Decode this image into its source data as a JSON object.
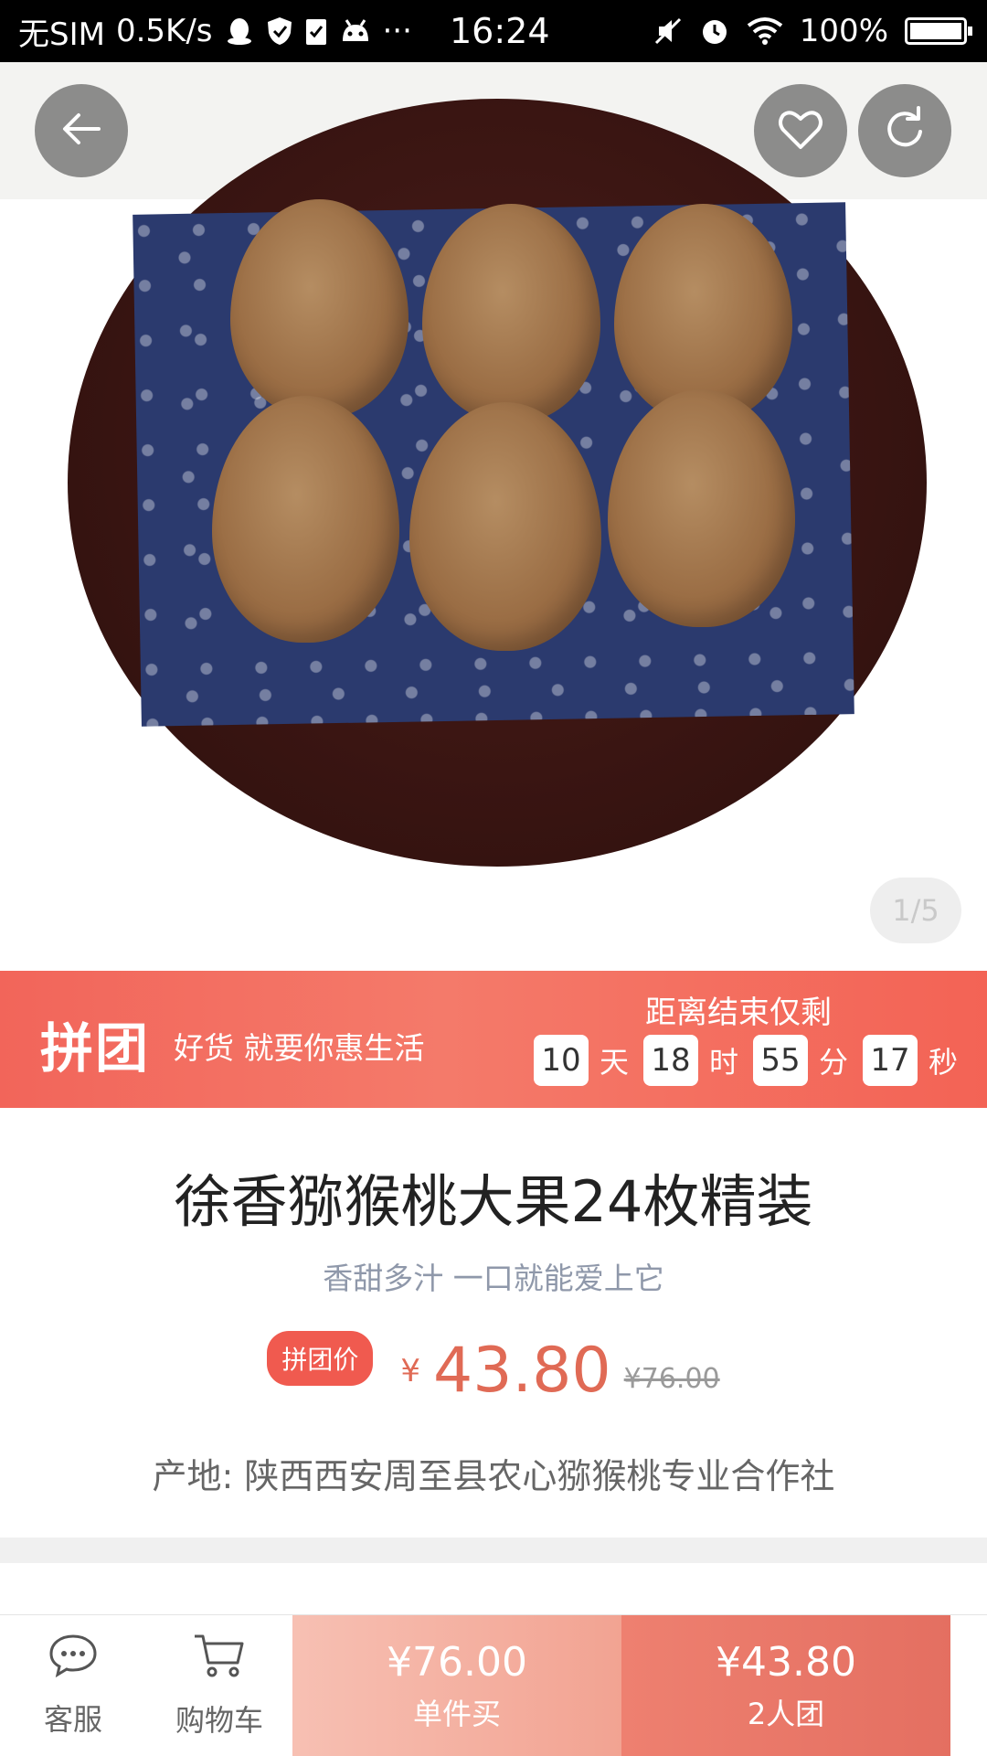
{
  "status_bar": {
    "carrier": "无SIM",
    "speed": "0.5K/s",
    "dots": "···",
    "time": "16:24",
    "battery": "100%"
  },
  "gallery": {
    "indicator": "1/5"
  },
  "group_banner": {
    "logo": "拼团",
    "slogan": "好货 就要你惠生活",
    "countdown_title": "距离结束仅剩",
    "countdown": [
      {
        "value": "10",
        "unit": "天"
      },
      {
        "value": "18",
        "unit": "时"
      },
      {
        "value": "55",
        "unit": "分"
      },
      {
        "value": "17",
        "unit": "秒"
      }
    ]
  },
  "product": {
    "title": "徐香猕猴桃大果24枚精装",
    "subtitle": "香甜多汁 一口就能爱上它",
    "price_tag": "拼团价",
    "currency": "¥",
    "price": "43.80",
    "original_price": "¥76.00",
    "origin": "产地: 陕西西安周至县农心猕猴桃专业合作社"
  },
  "bottom_bar": {
    "service_label": "客服",
    "cart_label": "购物车",
    "single_price": "¥76.00",
    "single_label": "单件买",
    "group_price": "¥43.80",
    "group_label": "2人团"
  }
}
